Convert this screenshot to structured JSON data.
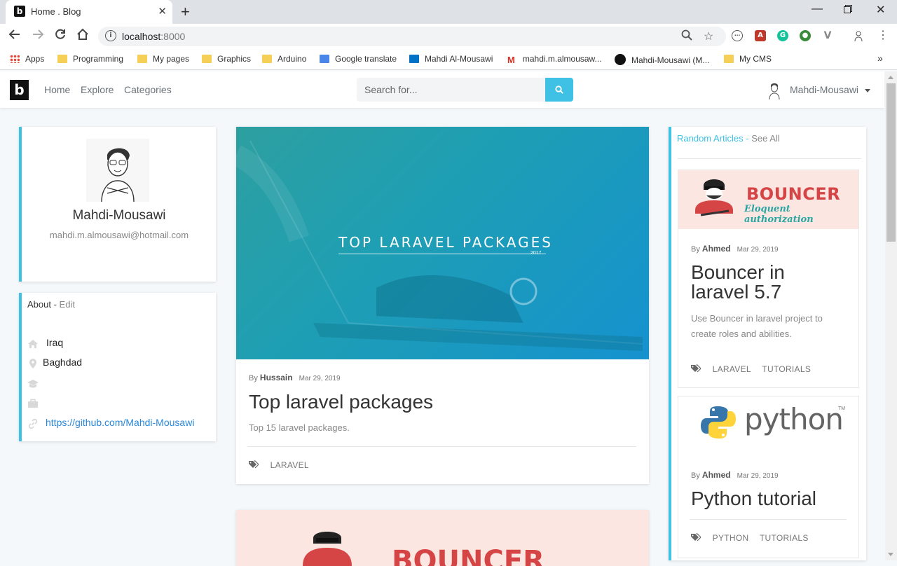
{
  "browser": {
    "tab_title": "Home . Blog",
    "favicon_letter": "b",
    "url_host": "localhost",
    "url_port": ":8000",
    "bookmarks": [
      {
        "label": "Apps",
        "icon": "apps-grid-icon"
      },
      {
        "label": "Programming",
        "icon": "folder-icon"
      },
      {
        "label": "My pages",
        "icon": "folder-icon"
      },
      {
        "label": "Graphics",
        "icon": "folder-icon"
      },
      {
        "label": "Arduino",
        "icon": "folder-icon"
      },
      {
        "label": "Google translate",
        "icon": "google-translate-icon"
      },
      {
        "label": "Mahdi Al-Mousawi",
        "icon": "outlook-icon"
      },
      {
        "label": "mahdi.m.almousaw...",
        "icon": "gmail-icon"
      },
      {
        "label": "Mahdi-Mousawi (M...",
        "icon": "github-icon"
      },
      {
        "label": "My CMS",
        "icon": "folder-icon"
      }
    ]
  },
  "site": {
    "brand_letter": "b",
    "nav": [
      "Home",
      "Explore",
      "Categories"
    ],
    "search_placeholder": "Search for...",
    "user_name": "Mahdi-Mousawi",
    "accent_color": "#3ec1e4"
  },
  "profile": {
    "name": "Mahdi-Mousawi",
    "email": "mahdi.m.almousawi@hotmail.com"
  },
  "about": {
    "title": "About -",
    "edit_label": "Edit",
    "country": "Iraq",
    "city": "Baghdad",
    "education": "",
    "work": "",
    "website": "https://github.com/Mahdi-Mousawi"
  },
  "main_article": {
    "hero_title": "TOP LARAVEL PACKAGES",
    "hero_year": "2017",
    "by": "By",
    "author": "Hussain",
    "date": "Mar 29, 2019",
    "title": "Top laravel packages",
    "description": "Top 15 laravel packages.",
    "tags": [
      "LARAVEL"
    ]
  },
  "second_article": {
    "banner_word": "BOUNCER"
  },
  "sidebar": {
    "heading": "Random Articles -",
    "see_all": "See All",
    "articles": [
      {
        "banner_word": "BOUNCER",
        "banner_sub": "Eloquent authorization",
        "by": "By",
        "author": "Ahmed",
        "date": "Mar 29, 2019",
        "title_line1": "Bouncer in",
        "title_line2": "laravel 5.7",
        "description_line1": "Use Bouncer in laravel project to",
        "description_line2": "create roles and abilities.",
        "tags": [
          "LARAVEL",
          "TUTORIALS"
        ]
      },
      {
        "banner_word": "python",
        "banner_tm": "TM",
        "by": "By",
        "author": "Ahmed",
        "date": "Mar 29, 2019",
        "title": "Python tutorial",
        "tags": [
          "PYTHON",
          "TUTORIALS"
        ]
      }
    ]
  }
}
